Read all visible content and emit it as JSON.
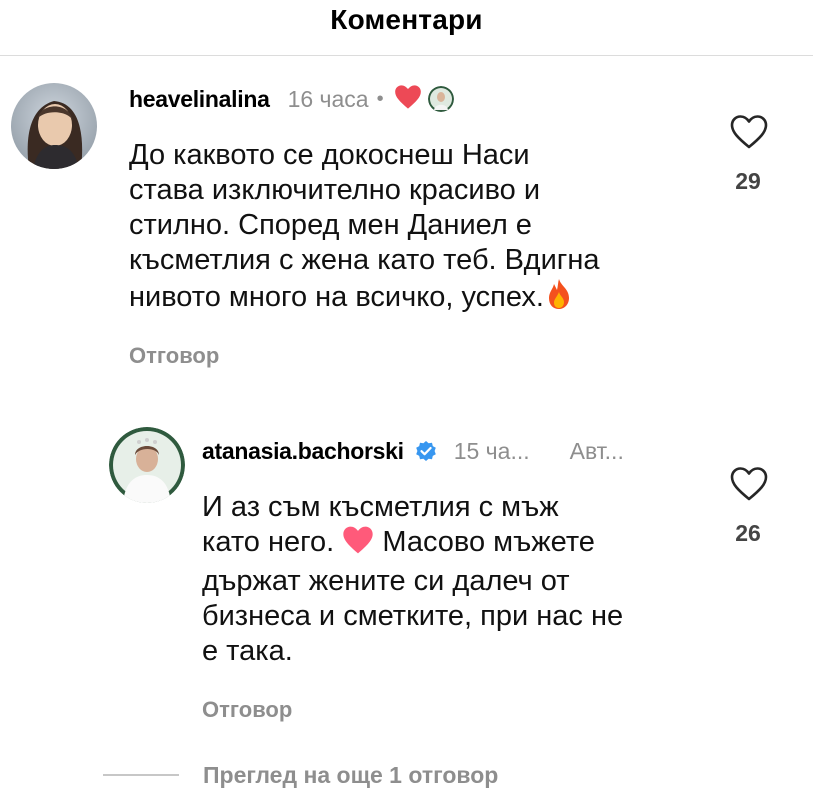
{
  "header": {
    "title": "Коментари"
  },
  "comments": [
    {
      "username": "heavelinalina",
      "time": "16 часа",
      "text_lines": [
        "До каквото се докоснеш Наси",
        "става изключително красиво и",
        "стилно. Според мен Даниел е",
        "късметлия с жена като теб. Вдигна",
        "нивото много на всичко, успех."
      ],
      "reply_label": "Отговор",
      "likes": "29"
    },
    {
      "username": "atanasia.bachorski",
      "time": "15 ча...",
      "author_badge": "Авт...",
      "text_lines": [
        "И аз съм късметлия с мъж",
        "като него.",
        " Масово мъжете",
        "държат жените си далеч от",
        "бизнеса и сметките, при нас не",
        "е така."
      ],
      "reply_label": "Отговор",
      "likes": "26"
    }
  ],
  "view_more_replies": "Преглед на още 1 отговор",
  "colors": {
    "muted": "#8e8e8e",
    "verified": "#3897f0",
    "like_heart": "#ed4956",
    "pink_heart": "#ff5a7a"
  },
  "icons": [
    "heart-outline-icon",
    "red-heart-icon",
    "verified-badge-icon",
    "fire-emoji-icon",
    "pink-heart-emoji-icon"
  ]
}
